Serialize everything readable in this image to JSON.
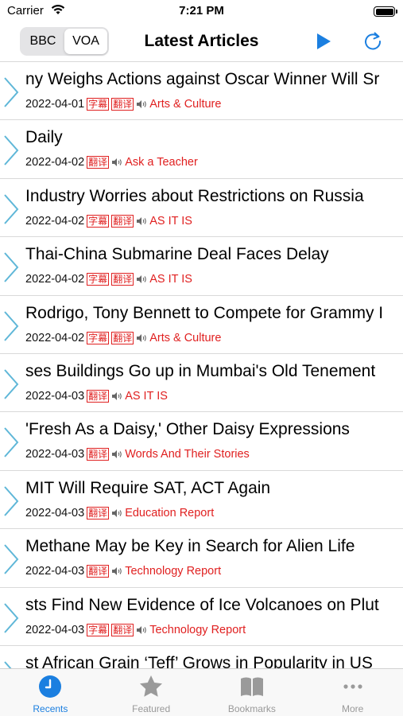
{
  "status_bar": {
    "carrier": "Carrier",
    "time": "7:21 PM"
  },
  "nav": {
    "segments": [
      "BBC",
      "VOA"
    ],
    "selected_segment": "VOA",
    "title": "Latest Articles"
  },
  "articles": [
    {
      "title": "ny Weighs Actions against Oscar Winner Will Sr",
      "date": "2022-04-01",
      "badges": [
        "字幕",
        "翻译"
      ],
      "category": "Arts & Culture"
    },
    {
      "title": "Daily",
      "date": "2022-04-02",
      "badges": [
        "翻译"
      ],
      "category": "Ask a Teacher"
    },
    {
      "title": "Industry Worries about Restrictions on Russia",
      "date": "2022-04-02",
      "badges": [
        "字幕",
        "翻译"
      ],
      "category": "AS IT IS"
    },
    {
      "title": "Thai-China Submarine Deal Faces Delay",
      "date": "2022-04-02",
      "badges": [
        "字幕",
        "翻译"
      ],
      "category": "AS IT IS"
    },
    {
      "title": "Rodrigo, Tony Bennett to Compete for Grammy I",
      "date": "2022-04-02",
      "badges": [
        "字幕",
        "翻译"
      ],
      "category": "Arts & Culture"
    },
    {
      "title": "ses Buildings Go up in Mumbai's Old Tenement",
      "date": "2022-04-03",
      "badges": [
        "翻译"
      ],
      "category": "AS IT IS"
    },
    {
      "title": "'Fresh As a Daisy,' Other Daisy Expressions",
      "date": "2022-04-03",
      "badges": [
        "翻译"
      ],
      "category": "Words And Their Stories"
    },
    {
      "title": "MIT Will Require SAT, ACT Again",
      "date": "2022-04-03",
      "badges": [
        "翻译"
      ],
      "category": "Education Report"
    },
    {
      "title": "Methane May be Key in Search for Alien Life",
      "date": "2022-04-03",
      "badges": [
        "翻译"
      ],
      "category": "Technology Report"
    },
    {
      "title": "sts Find New Evidence of Ice Volcanoes on Plut",
      "date": "2022-04-03",
      "badges": [
        "字幕",
        "翻译"
      ],
      "category": "Technology Report"
    },
    {
      "title": "st African Grain ‘Teff’ Grows in Popularity in US",
      "date": "",
      "badges": [],
      "category": ""
    }
  ],
  "tabs": [
    {
      "label": "Recents",
      "icon": "clock-icon",
      "active": true
    },
    {
      "label": "Featured",
      "icon": "star-icon",
      "active": false
    },
    {
      "label": "Bookmarks",
      "icon": "book-icon",
      "active": false
    },
    {
      "label": "More",
      "icon": "more-icon",
      "active": false
    }
  ],
  "colors": {
    "accent": "#1b7fe0",
    "tag_red": "#e02020",
    "chevron": "#5fb7d8",
    "inactive_tab": "#999999"
  }
}
